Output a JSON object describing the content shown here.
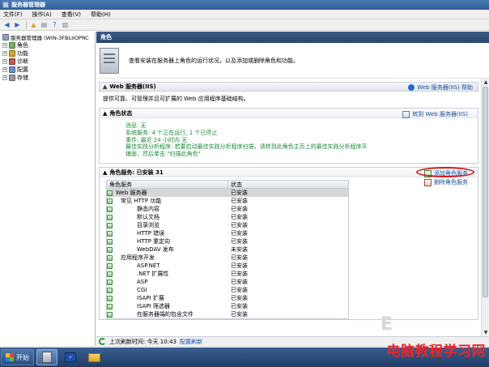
{
  "window": {
    "title": "服务器管理器"
  },
  "menu": [
    "文件(F)",
    "操作(A)",
    "查看(V)",
    "帮助(H)"
  ],
  "tree": {
    "root": "服务器管理器 (WIN-3FBLIIOPRC",
    "items": [
      "角色",
      "功能",
      "诊断",
      "配置",
      "存储"
    ]
  },
  "content": {
    "header": "角色",
    "intro": "查看安装在服务器上角色的运行状况，以及添加或删除角色和功能。",
    "web_section": {
      "title": "Web 服务器(IIS)",
      "help": "Web 服务器(IIS) 帮助",
      "description": "提供可靠、可管理并且可扩展的 Web 应用程序基础结构。"
    },
    "role_status": {
      "title": "角色状态",
      "goto": "转到 Web 服务器(IIS)",
      "messages": "消息: 无",
      "system_services": "系统服务: 4 个正在运行, 1 个已停止",
      "events": "事件: 最近 24 小时内 无",
      "best_practice": "最佳实践分析程序: 若要启动最佳实践分析程序扫描，请转到此角色主页上的最佳实践分析程序平铺面，然后单击 \"扫描此角色\""
    },
    "role_services": {
      "title": "角色服务: 已安装 31",
      "add": "添加角色服务",
      "remove": "删除角色服务",
      "col_service": "角色服务",
      "col_status": "状态",
      "rows": [
        {
          "name": "Web 服务器",
          "status": "已安装"
        },
        {
          "name": "常见 HTTP 功能",
          "status": "已安装"
        },
        {
          "name": "静态内容",
          "status": "已安装"
        },
        {
          "name": "默认文档",
          "status": "已安装"
        },
        {
          "name": "目录浏览",
          "status": "已安装"
        },
        {
          "name": "HTTP 错误",
          "status": "已安装"
        },
        {
          "name": "HTTP 重定向",
          "status": "已安装"
        },
        {
          "name": "WebDAV 发布",
          "status": "未安装"
        },
        {
          "name": "应用程序开发",
          "status": "已安装"
        },
        {
          "name": "ASP.NET",
          "status": "已安装"
        },
        {
          "name": ".NET 扩展性",
          "status": "已安装"
        },
        {
          "name": "ASP",
          "status": "已安装"
        },
        {
          "name": "CGI",
          "status": "已安装"
        },
        {
          "name": "ISAPI 扩展",
          "status": "已安装"
        },
        {
          "name": "ISAPI 筛选器",
          "status": "已安装"
        },
        {
          "name": "在服务器端的包含文件",
          "status": "已安装"
        }
      ]
    },
    "refresh": {
      "text": "上次刷新时间: 今天 10:43",
      "link": "配置刷新"
    }
  },
  "taskbar": {
    "start": "开始"
  },
  "watermark": "电脑教程学习网"
}
